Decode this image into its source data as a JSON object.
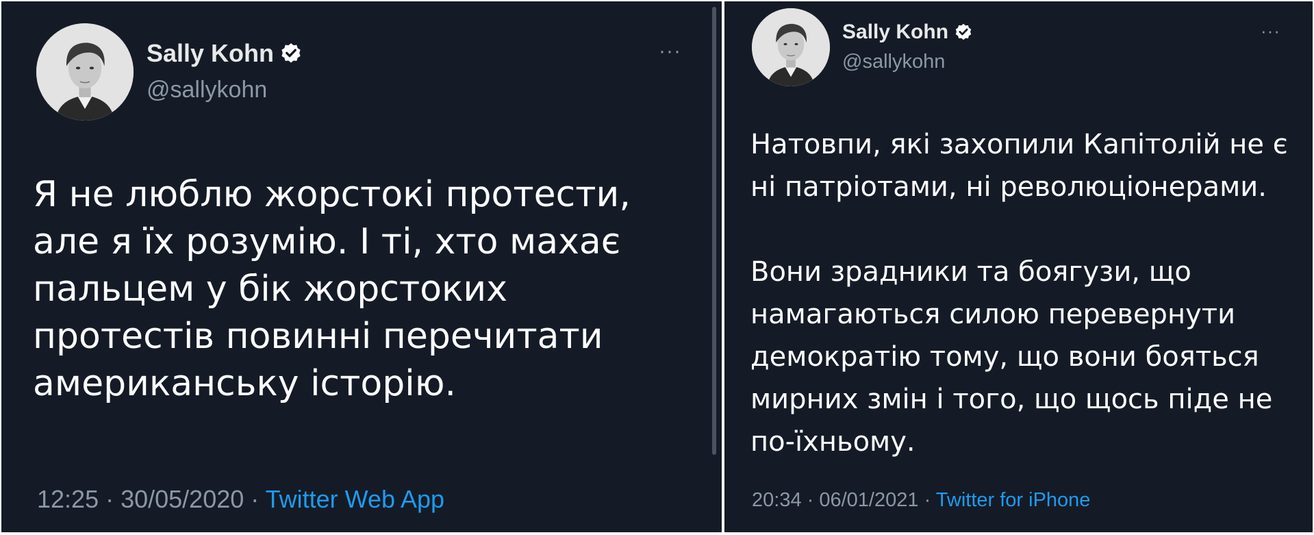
{
  "colors": {
    "background": "#151b26",
    "text": "#ffffff",
    "secondary": "#8b98a5",
    "link": "#1d9bf0",
    "verified": "#ffffff"
  },
  "tweets": [
    {
      "author": {
        "name": "Sally Kohn",
        "handle": "@sallykohn",
        "verified": true,
        "avatar": "profile-photo"
      },
      "more_icon": "···",
      "text": "Я не люблю жорстокі протести,\nале я їх розумію. І ті, хто махає\nпальцем у бік жорстоких\nпротестів повинні перечитати\nамериканську історію.",
      "time": "12:25",
      "date": "30/05/2020",
      "separator": " · ",
      "source": "Twitter Web App"
    },
    {
      "author": {
        "name": "Sally Kohn",
        "handle": "@sallykohn",
        "verified": true,
        "avatar": "profile-photo"
      },
      "more_icon": "···",
      "text": "Натовпи, які захопили Капітолій не є\nні патріотами, ні революціонерами.\n\nВони зрадники та боягузи, що\nнамагаються силою перевернути\nдемократію тому, що вони бояться\nмирних змін і того, що щось піде не\nпо-їхньому.",
      "time": "20:34",
      "date": "06/01/2021",
      "separator": " · ",
      "source": "Twitter for iPhone"
    }
  ]
}
